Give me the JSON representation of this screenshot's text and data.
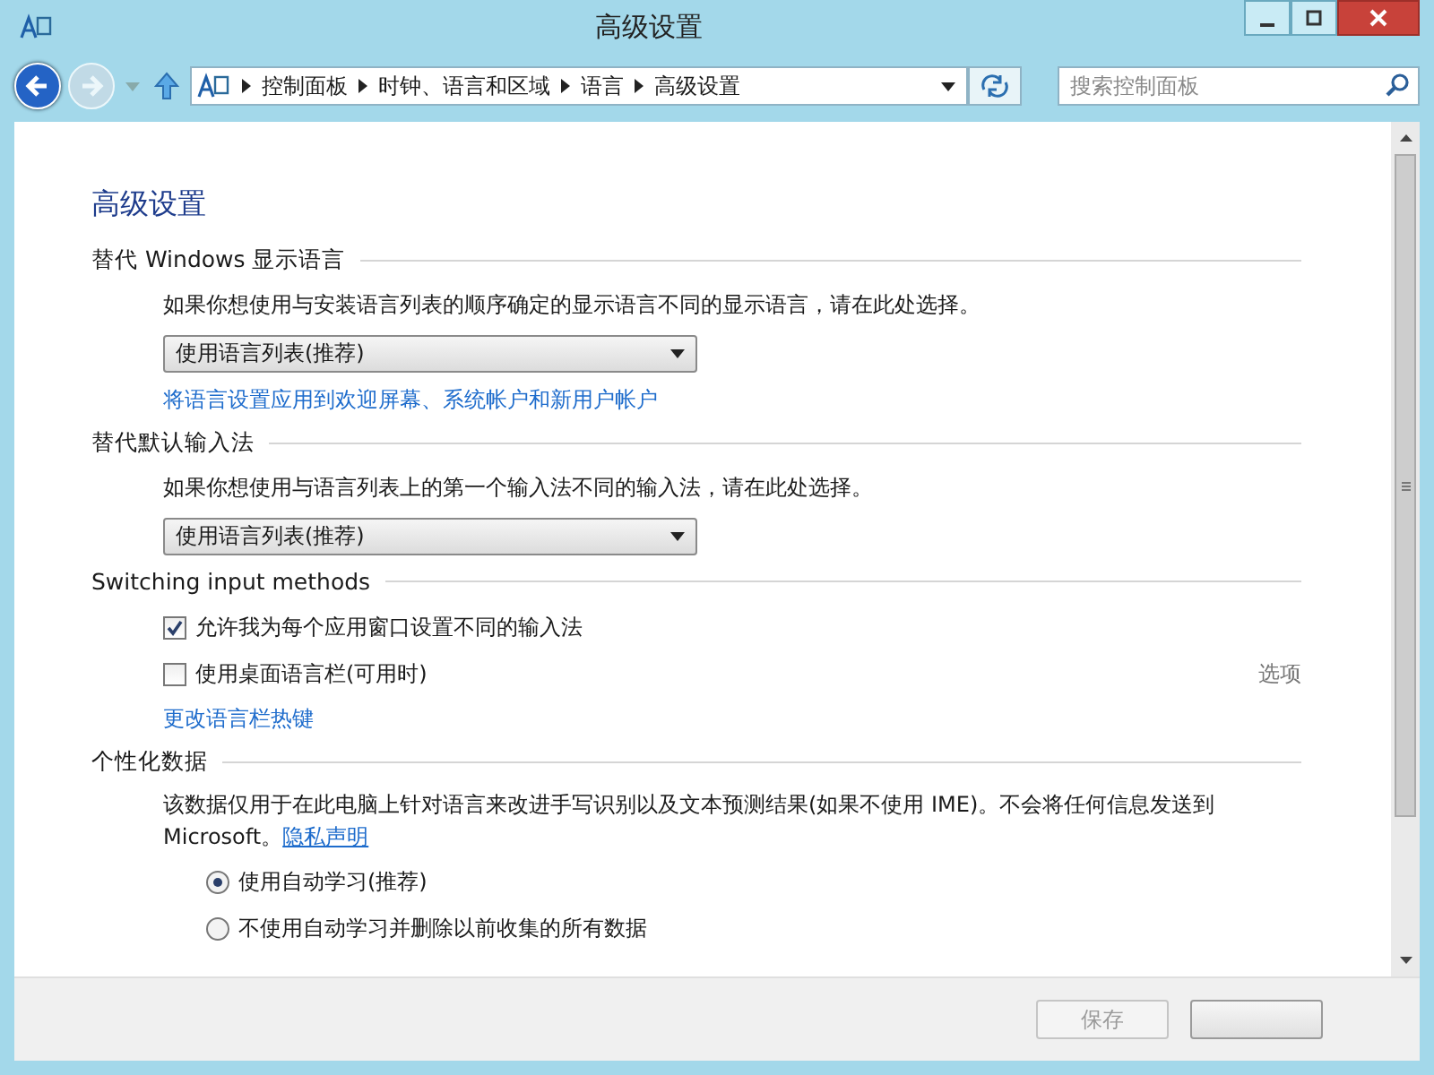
{
  "window": {
    "title": "高级设置"
  },
  "address": {
    "path": [
      "控制面板",
      "时钟、语言和区域",
      "语言",
      "高级设置"
    ],
    "search": {
      "placeholder": "搜索控制面板"
    }
  },
  "content": {
    "heading": "高级设置",
    "sections": [
      {
        "title": "替代 Windows 显示语言",
        "items": [
          {
            "kind": "text",
            "text": "如果你想使用与安装语言列表的顺序确定的显示语言不同的显示语言，请在此处选择。"
          },
          {
            "kind": "dropdown",
            "value": "使用语言列表(推荐)"
          },
          {
            "kind": "link",
            "text": "将语言设置应用到欢迎屏幕、系统帐户和新用户帐户"
          }
        ]
      },
      {
        "title": "替代默认输入法",
        "items": [
          {
            "kind": "text",
            "text": "如果你想使用与语言列表上的第一个输入法不同的输入法，请在此处选择。"
          },
          {
            "kind": "dropdown",
            "value": "使用语言列表(推荐)"
          }
        ]
      },
      {
        "title": "Switching input methods",
        "items": [
          {
            "kind": "checkbox",
            "label": "允许我为每个应用窗口设置不同的输入法",
            "checked": true
          },
          {
            "kind": "checkbox",
            "label": "使用桌面语言栏(可用时)",
            "checked": false,
            "aside": "选项"
          },
          {
            "kind": "link",
            "text": "更改语言栏热键"
          }
        ]
      },
      {
        "title": "个性化数据",
        "items": [
          {
            "kind": "paragraph",
            "text": "该数据仅用于在此电脑上针对语言来改进手写识别以及文本预测结果(如果不使用 IME)。不会将任何信息发送到 Microsoft。",
            "link": "隐私声明"
          },
          {
            "kind": "radio",
            "label": "使用自动学习(推荐)",
            "selected": true
          },
          {
            "kind": "radio",
            "label": "不使用自动学习并删除以前收集的所有数据",
            "selected": false
          }
        ]
      }
    ]
  },
  "footer": {
    "buttons": [
      {
        "label": "保存",
        "disabled": true
      },
      {
        "disabled": false
      }
    ]
  }
}
